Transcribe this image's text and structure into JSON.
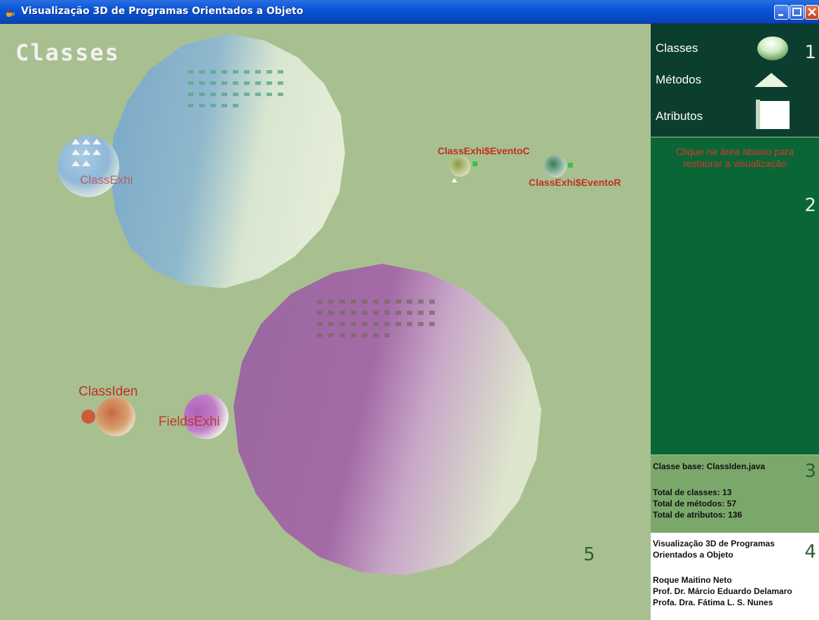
{
  "window": {
    "title": "Visualização 3D de Programas Orientados a Objeto"
  },
  "canvas": {
    "title": "Classes",
    "panel_number": "5",
    "labels": {
      "class_exhi": "ClassExhi",
      "evento_c": "ClassExhi$EventoC",
      "evento_r": "ClassExhi$EventoR",
      "class_iden": "ClassIden",
      "fields_exhi": "FieldsExhi"
    }
  },
  "legend": {
    "number": "1",
    "items": [
      {
        "label": "Classes",
        "icon": "sphere-icon"
      },
      {
        "label": "Métodos",
        "icon": "triangle-icon"
      },
      {
        "label": "Atributos",
        "icon": "square-icon"
      }
    ]
  },
  "restore": {
    "number": "2",
    "text": "Clique na área abaixo para restaurar a visualização"
  },
  "stats": {
    "number": "3",
    "base_class": "Classe base: ClassIden.java",
    "total_classes": "Total de classes: 13",
    "total_methods": "Total de métodos: 57",
    "total_attributes": "Total de atributos: 136"
  },
  "credits": {
    "number": "4",
    "title_line1": "Visualização 3D de Programas",
    "title_line2": "Orientados a Objeto",
    "author1": "Roque Maitino Neto",
    "author2": "Prof. Dr. Márcio Eduardo Delamaro",
    "author3": "Profa. Dra. Fátima L. S. Nunes"
  },
  "colors": {
    "canvas_bg": "#a8c090",
    "legend_bg": "#0c3e30",
    "restore_bg": "#0a6636",
    "stats_bg": "#7aa86a",
    "label_red": "#c03020"
  }
}
